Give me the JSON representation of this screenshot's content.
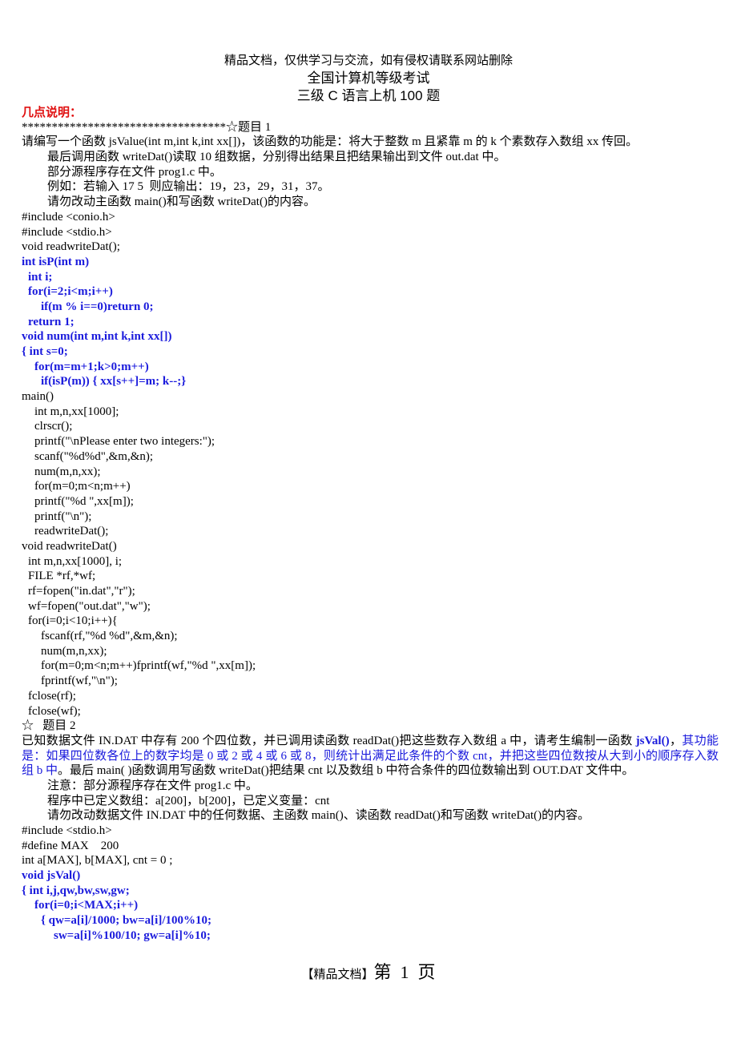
{
  "header": {
    "watermark": "精品文档，仅供学习与交流，如有侵权请联系网站删除",
    "title_line1": "全国计算机等级考试",
    "title_line2": "三级 C 语言上机 100 题"
  },
  "notes_heading": "几点说明：",
  "problem1": {
    "separator": "**********************************☆题目 1",
    "description": [
      "请编写一个函数 jsValue(int m,int k,int xx[])，该函数的功能是：将大于整数 m 且紧靠 m 的 k 个素数存入数组 xx 传回。",
      "最后调用函数 writeDat()读取 10 组数据，分别得出结果且把结果输出到文件 out.dat 中。",
      "部分源程序存在文件 prog1.c 中。",
      "例如：若输入 17 5  则应输出：19，23，29，31，37。",
      "请勿改动主函数 main()和写函数 writeDat()的内容。"
    ],
    "code_plain_head": [
      "#include <conio.h>",
      "#include <stdio.h>",
      "void readwriteDat();"
    ],
    "code_answer": [
      {
        "indent": 0,
        "text": "int isP(int m)"
      },
      {
        "indent": 1,
        "text": "int i;"
      },
      {
        "indent": 1,
        "text": "for(i=2;i<m;i++)"
      },
      {
        "indent": 3,
        "text": "if(m % i==0)return 0;"
      },
      {
        "indent": 1,
        "text": "return 1;"
      },
      {
        "indent": 0,
        "text": "void num(int m,int k,int xx[])"
      },
      {
        "indent": 0,
        "text": "{ int s=0;"
      },
      {
        "indent": 2,
        "text": "for(m=m+1;k>0;m++)"
      },
      {
        "indent": 3,
        "text": "if(isP(m)) { xx[s++]=m; k--;}"
      }
    ],
    "code_main": [
      {
        "indent": 0,
        "text": "main()"
      },
      {
        "indent": 2,
        "text": "int m,n,xx[1000];"
      },
      {
        "indent": 2,
        "text": "clrscr();"
      },
      {
        "indent": 2,
        "text": "printf(\"\\nPlease enter two integers:\");"
      },
      {
        "indent": 2,
        "text": "scanf(\"%d%d\",&m,&n);"
      },
      {
        "indent": 2,
        "text": "num(m,n,xx);"
      },
      {
        "indent": 2,
        "text": "for(m=0;m<n;m++)"
      },
      {
        "indent": 2,
        "text": "printf(\"%d \",xx[m]);"
      },
      {
        "indent": 2,
        "text": "printf(\"\\n\");"
      },
      {
        "indent": 2,
        "text": "readwriteDat();"
      },
      {
        "indent": 0,
        "text": "void readwriteDat()"
      },
      {
        "indent": 1,
        "text": "int m,n,xx[1000], i;"
      },
      {
        "indent": 1,
        "text": "FILE *rf,*wf;"
      },
      {
        "indent": 1,
        "text": "rf=fopen(\"in.dat\",\"r\");"
      },
      {
        "indent": 1,
        "text": "wf=fopen(\"out.dat\",\"w\");"
      },
      {
        "indent": 1,
        "text": "for(i=0;i<10;i++){"
      },
      {
        "indent": 3,
        "text": "fscanf(rf,\"%d %d\",&m,&n);"
      },
      {
        "indent": 3,
        "text": "num(m,n,xx);"
      },
      {
        "indent": 3,
        "text": "for(m=0;m<n;m++)fprintf(wf,\"%d \",xx[m]);"
      },
      {
        "indent": 3,
        "text": "fprintf(wf,\"\\n\");"
      },
      {
        "indent": 1,
        "text": "fclose(rf);"
      },
      {
        "indent": 1,
        "text": "fclose(wf);"
      }
    ]
  },
  "problem2": {
    "heading": "☆   题目 2",
    "desc_part1": "已知数据文件 IN.DAT 中存有 200 个四位数，并已调用读函数 readDat()把这些数存入数组 a 中，请考生编制一函数 ",
    "desc_func": "jsVal()",
    "desc_part2": "，",
    "desc_blue": "其功能是：如果四位数各位上的数字均是 0 或 2 或 4 或 6 或 8，则统计出满足此条件的个数 cnt，并把这些四位数按从大到小的顺序存入数组 b 中",
    "desc_part3": "。最后 main( )函数调用写函数 writeDat()把结果 cnt 以及数组 b 中符合条件的四位数输出到 OUT.DAT 文件中。",
    "notes": [
      "注意：部分源程序存在文件 prog1.c 中。",
      "程序中已定义数组：a[200]，b[200]，已定义变量：cnt",
      "请勿改动数据文件 IN.DAT 中的任何数据、主函数 main()、读函数 readDat()和写函数 writeDat()的内容。"
    ],
    "code_plain": [
      "#include <stdio.h>",
      "#define MAX    200",
      "int a[MAX], b[MAX], cnt = 0 ;"
    ],
    "code_answer": [
      {
        "indent": 0,
        "text": "void jsVal()"
      },
      {
        "indent": 0,
        "text": "{ int i,j,qw,bw,sw,gw;"
      },
      {
        "indent": 2,
        "text": "for(i=0;i<MAX;i++)"
      },
      {
        "indent": 3,
        "text": "{ qw=a[i]/1000; bw=a[i]/100%10;"
      },
      {
        "indent": 5,
        "text": "sw=a[i]%100/10; gw=a[i]%10;"
      }
    ]
  },
  "footer": {
    "brand": "【精品文档】",
    "page_prefix": "第",
    "page_number": "1",
    "page_suffix": "页"
  },
  "colors": {
    "heading_red": "#e01010",
    "answer_blue": "#1a1adc"
  }
}
